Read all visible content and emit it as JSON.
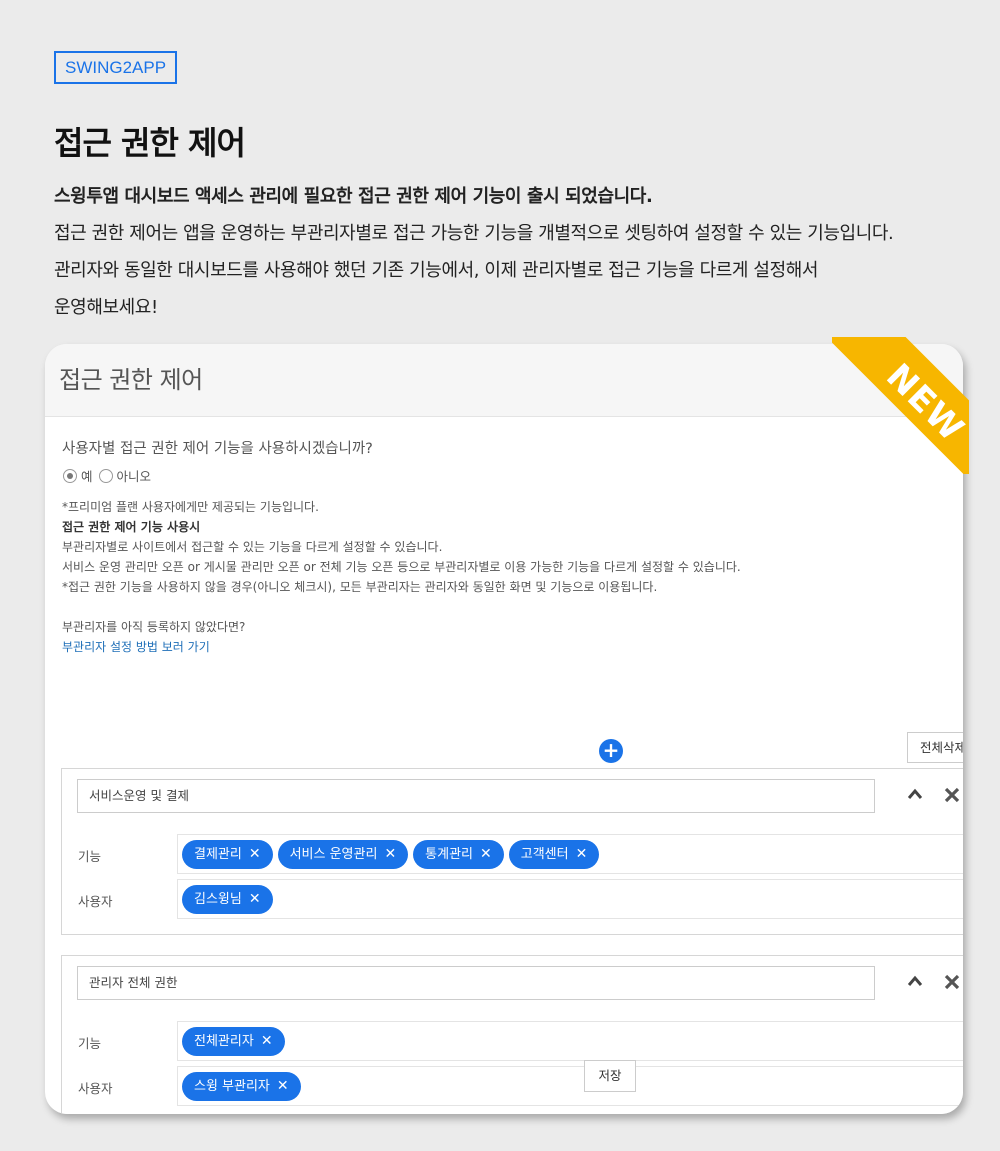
{
  "brand": {
    "tag": "SWING2APP"
  },
  "page": {
    "title": "접근 권한 제어",
    "intro_lead": "스윙투앱 대시보드 액세스 관리에 필요한 접근 권한 제어 기능이 출시 되었습니다.",
    "intro_lines": [
      "접근 권한 제어는 앱을 운영하는 부관리자별로 접근 가능한 기능을 개별적으로 셋팅하여 설정할 수 있는 기능입니다.",
      "관리자와 동일한 대시보드를 사용해야 했던 기존 기능에서, 이제 관리자별로 접근 기능을 다르게 설정해서",
      "운영해보세요!"
    ]
  },
  "badge": {
    "text": "NEW",
    "color": "#f7b600"
  },
  "panel": {
    "title": "접근 권한 제어",
    "question": "사용자별 접근 권한 제어 기능을 사용하시겠습니까?",
    "radio_yes": "예",
    "radio_no": "아니오",
    "selected": "예",
    "notes": [
      "*프리미엄 플랜 사용자에게만 제공되는 기능입니다.",
      "접근 권한 제어 기능 사용시",
      "부관리자별로 사이트에서 접근할 수 있는 기능을 다르게 설정할 수 있습니다.",
      "서비스 운영 관리만 오픈 or 게시물 관리만 오픈 or 전체 기능 오픈 등으로 부관리자별로 이용 가능한 기능을 다르게 설정할 수 있습니다.",
      "*접근 권한 기능을 사용하지 않을 경우(아니오 체크시), 모든 부관리자는 관리자와 동일한 화면 및 기능으로 이용됩니다."
    ],
    "sub_question": "부관리자를 아직 등록하지 않았다면?",
    "help_link": "부관리자 설정 방법 보러 가기",
    "add_symbol": "+",
    "delete_all": "전체삭제",
    "save": "저장",
    "feature_label": "기능",
    "user_label": "사용자",
    "accent": "#1a73e8",
    "groups": [
      {
        "name": "서비스운영 및 결제",
        "features": [
          "결제관리",
          "서비스 운영관리",
          "통계관리",
          "고객센터"
        ],
        "users": [
          "김스윙님"
        ]
      },
      {
        "name": "관리자 전체 권한",
        "features": [
          "전체관리자"
        ],
        "users": [
          "스윙 부관리자"
        ]
      }
    ]
  }
}
